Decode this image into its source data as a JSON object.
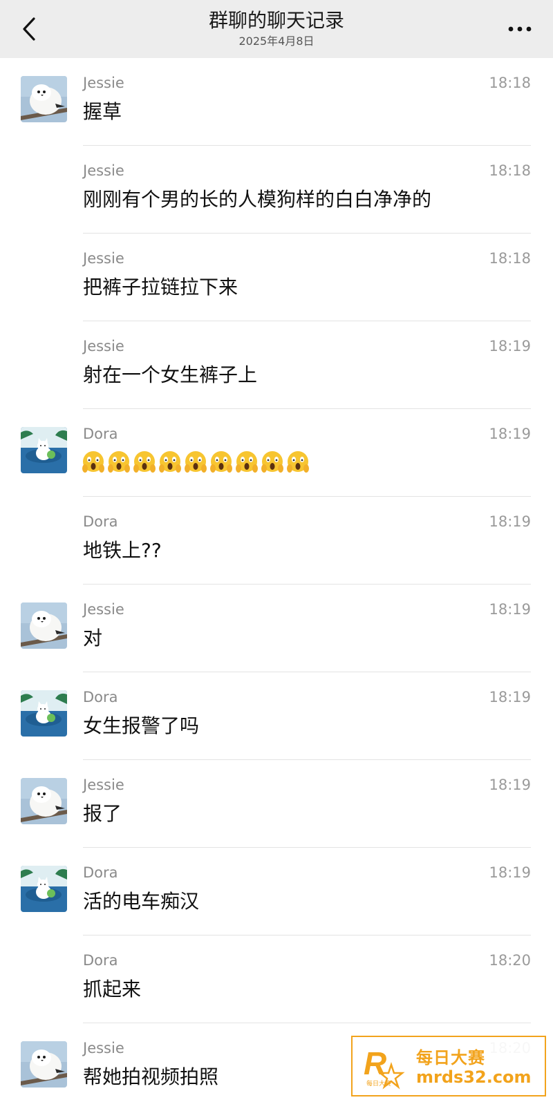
{
  "header": {
    "title": "群聊的聊天记录",
    "date": "2025年4月8日"
  },
  "colors": {
    "header_bg": "#ededed",
    "divider": "#e3e3e3",
    "watermark": "#f2a31c"
  },
  "messages": [
    {
      "sender": "Jessie",
      "time": "18:18",
      "text": "握草",
      "avatar": "jessie-bird"
    },
    {
      "sender": "Jessie",
      "time": "18:18",
      "text": "刚刚有个男的长的人模狗样的白白净净的",
      "avatar": ""
    },
    {
      "sender": "Jessie",
      "time": "18:18",
      "text": "把裤子拉链拉下来",
      "avatar": ""
    },
    {
      "sender": "Jessie",
      "time": "18:19",
      "text": "射在一个女生裤子上",
      "avatar": ""
    },
    {
      "sender": "Dora",
      "time": "18:19",
      "text": "😱😱😱😱😱😱😱😱😱",
      "avatar": "dora-cat"
    },
    {
      "sender": "Dora",
      "time": "18:19",
      "text": "地铁上??",
      "avatar": ""
    },
    {
      "sender": "Jessie",
      "time": "18:19",
      "text": "对",
      "avatar": "jessie-bird"
    },
    {
      "sender": "Dora",
      "time": "18:19",
      "text": "女生报警了吗",
      "avatar": "dora-cat"
    },
    {
      "sender": "Jessie",
      "time": "18:19",
      "text": "报了",
      "avatar": "jessie-bird"
    },
    {
      "sender": "Dora",
      "time": "18:19",
      "text": "活的电车痴汉",
      "avatar": "dora-cat"
    },
    {
      "sender": "Dora",
      "time": "18:20",
      "text": "抓起来",
      "avatar": ""
    },
    {
      "sender": "Jessie",
      "time": "18:20",
      "text": "帮她拍视频拍照",
      "avatar": "jessie-bird"
    }
  ],
  "watermark": {
    "logo_letter": "R",
    "logo_small": "每日大赛",
    "name": "每日大赛",
    "url": "mrds32.com"
  }
}
